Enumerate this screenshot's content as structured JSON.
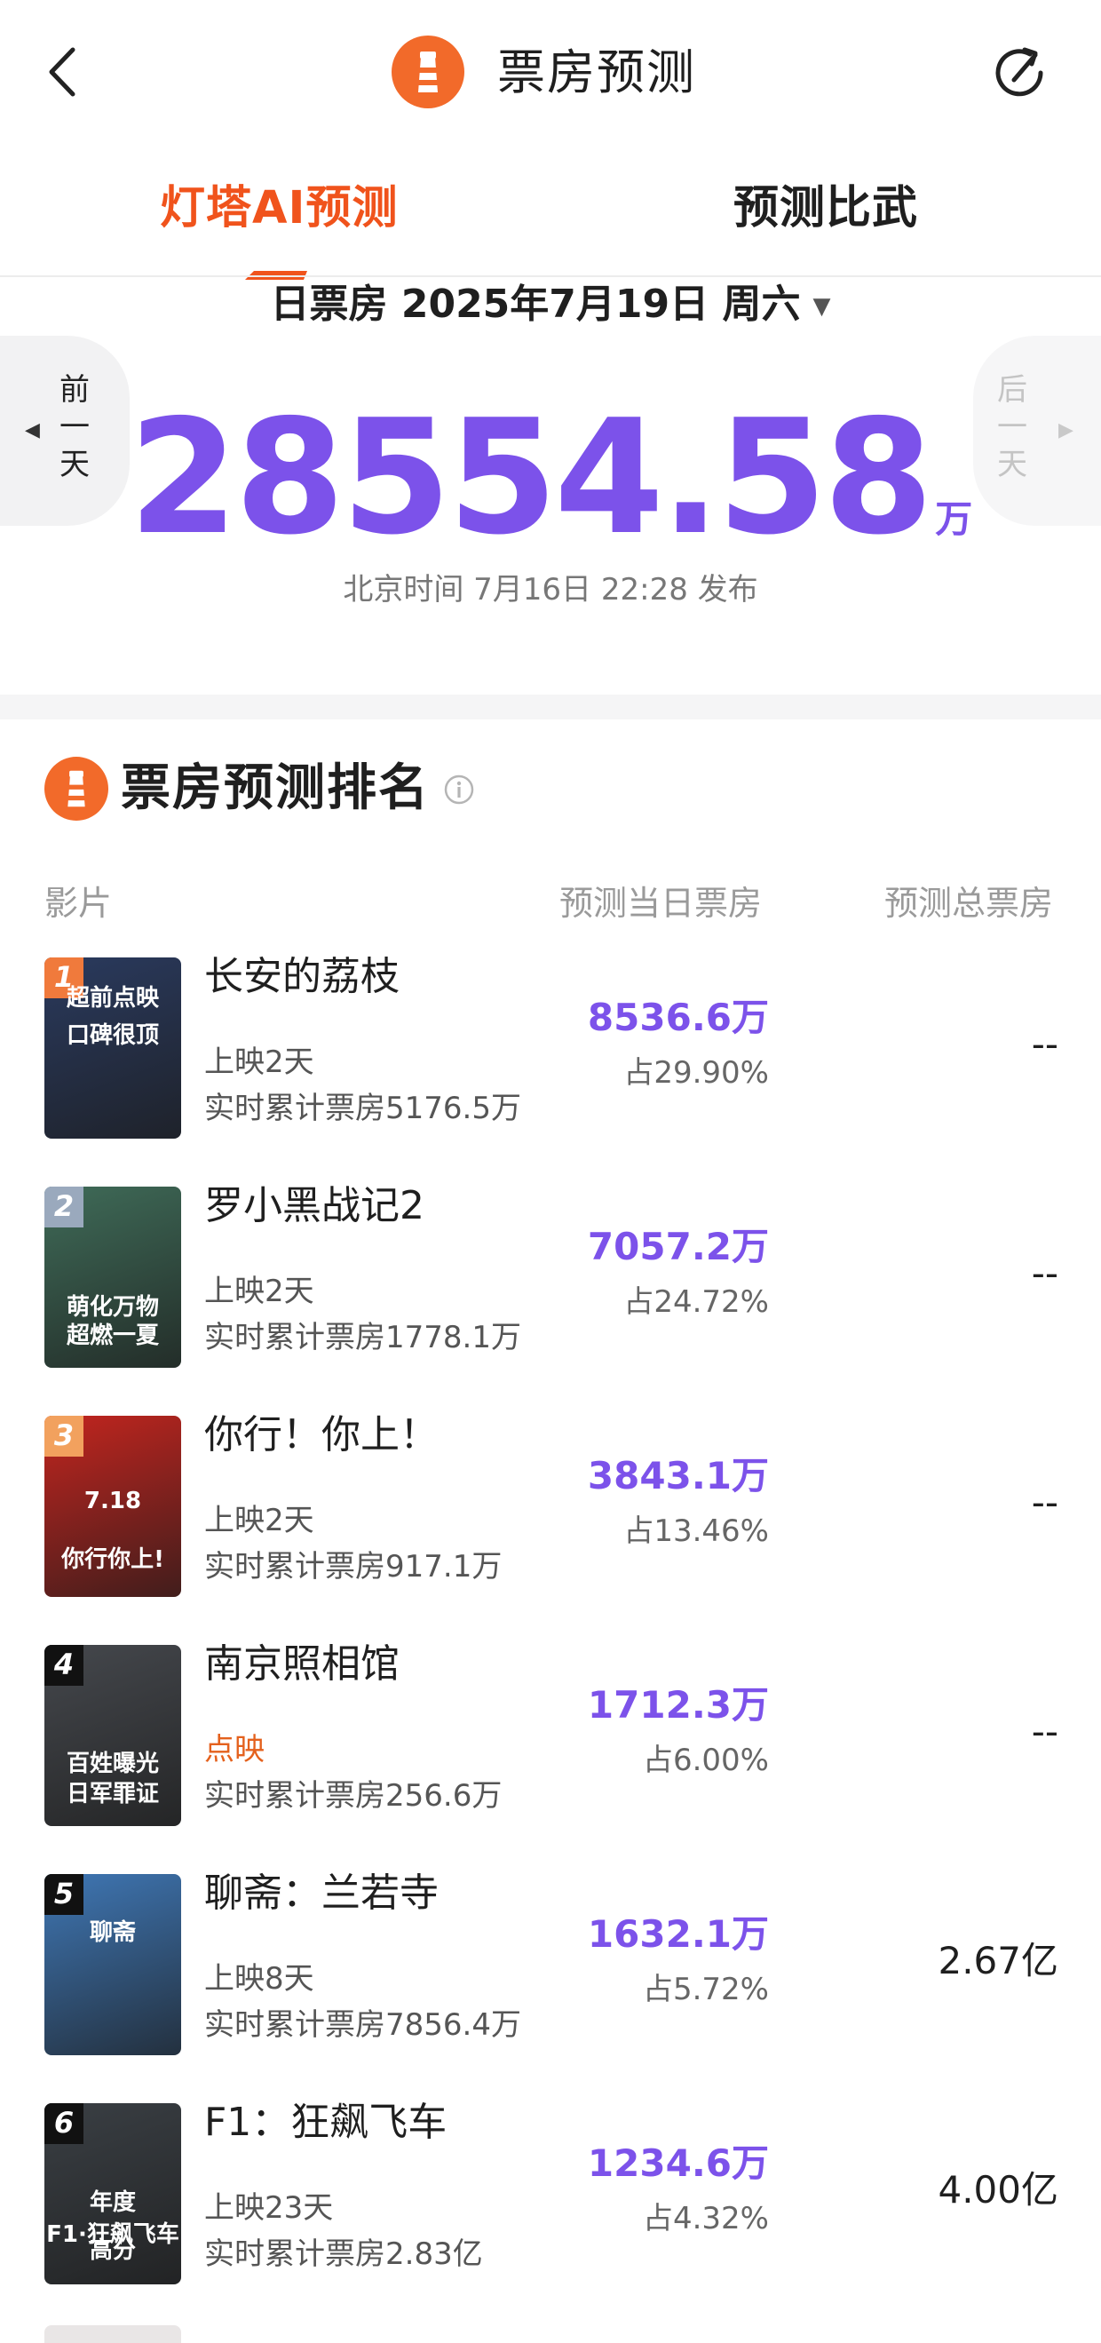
{
  "header": {
    "title": "票房预测",
    "back_icon": "chevron-left-icon",
    "share_icon": "share-refresh-icon"
  },
  "tabs": [
    {
      "label": "灯塔AI预测",
      "active": true
    },
    {
      "label": "预测比武",
      "active": false
    }
  ],
  "date_selector": {
    "label": "日票房 2025年7月19日 周六",
    "caret": "▼"
  },
  "nav": {
    "prev": [
      "前",
      "一",
      "天"
    ],
    "next": [
      "后",
      "一",
      "天"
    ]
  },
  "forecast": {
    "value": "28554.58",
    "unit": "万",
    "publish_note": "北京时间 7月16日 22:28 发布"
  },
  "ranking": {
    "title": "票房预测排名",
    "columns": [
      "影片",
      "预测当日票房",
      "预测总票房"
    ],
    "rows": [
      {
        "rank": "1",
        "name": "长安的荔枝",
        "status": "上映2天",
        "cumulative": "实时累计票房5176.5万",
        "pred_day": "8536.6万",
        "share": "占29.90%",
        "pred_total": "--",
        "poster_text": "超前点映 口碑很顶",
        "poster_color": "#2a3a5e",
        "badge_color": "#f07a3c"
      },
      {
        "rank": "2",
        "name": "罗小黑战记2",
        "status": "上映2天",
        "cumulative": "实时累计票房1778.1万",
        "pred_day": "7057.2万",
        "share": "占24.72%",
        "pred_total": "--",
        "poster_text": "萌化万物 超燃一夏",
        "poster_color": "#3f6b58",
        "badge_color": "#9aa9bd"
      },
      {
        "rank": "3",
        "name": "你行！你上！",
        "status": "上映2天",
        "cumulative": "实时累计票房917.1万",
        "pred_day": "3843.1万",
        "share": "占13.46%",
        "pred_total": "--",
        "poster_text": "7.18 你行你上!",
        "poster_color": "#c2251f",
        "badge_color": "#f2a15e"
      },
      {
        "rank": "4",
        "name": "南京照相馆",
        "status": "点映",
        "cumulative": "实时累计票房256.6万",
        "pred_day": "1712.3万",
        "share": "占6.00%",
        "pred_total": "--",
        "poster_text": "百姓曝光 日军罪证",
        "poster_color": "#45484d",
        "badge_color": "#111111"
      },
      {
        "rank": "5",
        "name": "聊斋：兰若寺",
        "status": "上映8天",
        "cumulative": "实时累计票房7856.4万",
        "pred_day": "1632.1万",
        "share": "占5.72%",
        "pred_total": "2.67亿",
        "poster_text": "聊斋",
        "poster_color": "#3f77b5",
        "badge_color": "#111111"
      },
      {
        "rank": "6",
        "name": "F1：狂飙飞车",
        "status": "上映23天",
        "cumulative": "实时累计票房2.83亿",
        "pred_day": "1234.6万",
        "share": "占4.32%",
        "pred_total": "4.00亿",
        "poster_text": "年度 高分 F1·狂飙飞车",
        "poster_color": "#3a3f44",
        "badge_color": "#111111"
      }
    ]
  },
  "colors": {
    "accent": "#7c52ea",
    "brand": "#f0531c",
    "hot_status": "#e4611d"
  }
}
